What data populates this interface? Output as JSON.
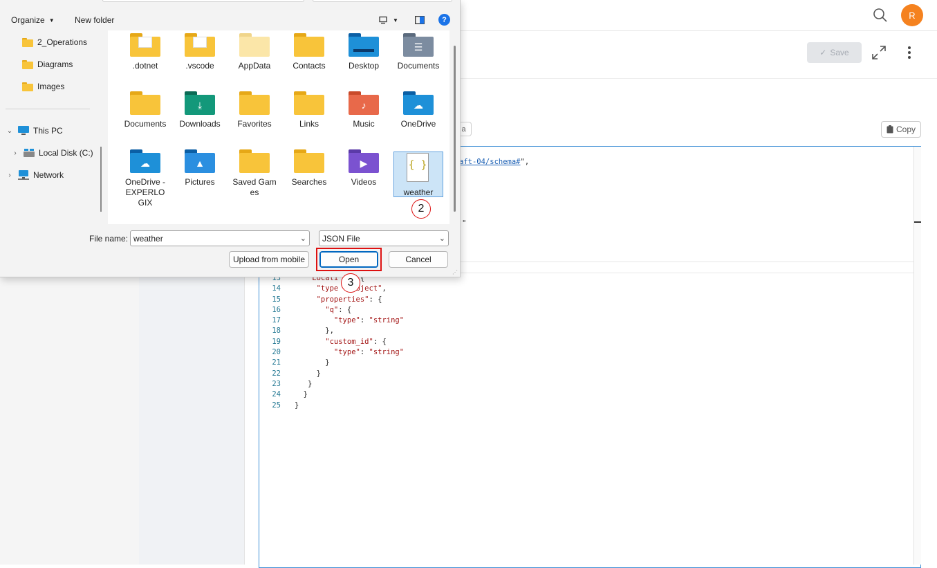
{
  "app": {
    "avatar_initial": "R",
    "save_label": "Save",
    "copy_label": "Copy",
    "tab_fragment": "a",
    "code_fragment_schema_url": "aft-04/schema#",
    "code_fragment_schema_tail": "\",",
    "code_fragment_quote": "\"",
    "code_lines": [
      {
        "n": "13",
        "html": "<span class=\"p\">    </span><span class=\"k\">Locati</span><span class=\"p\">     {</span>"
      },
      {
        "n": "14",
        "html": "<span class=\"p\">     </span><span class=\"k\">\"type</span><span class=\"p\">    </span><span class=\"s\">bject\"</span><span class=\"p\">,</span>"
      },
      {
        "n": "15",
        "html": "<span class=\"p\">     </span><span class=\"k\">\"properties\"</span><span class=\"p\">: {</span>"
      },
      {
        "n": "16",
        "html": "<span class=\"p\">       </span><span class=\"k\">\"q\"</span><span class=\"p\">: {</span>"
      },
      {
        "n": "17",
        "html": "<span class=\"p\">         </span><span class=\"k\">\"type\"</span><span class=\"p\">: </span><span class=\"s\">\"string\"</span>"
      },
      {
        "n": "18",
        "html": "<span class=\"p\">       },</span>"
      },
      {
        "n": "19",
        "html": "<span class=\"p\">       </span><span class=\"k\">\"custom_id\"</span><span class=\"p\">: {</span>"
      },
      {
        "n": "20",
        "html": "<span class=\"p\">         </span><span class=\"k\">\"type\"</span><span class=\"p\">: </span><span class=\"s\">\"string\"</span>"
      },
      {
        "n": "21",
        "html": "<span class=\"p\">       }</span>"
      },
      {
        "n": "22",
        "html": "<span class=\"p\">     }</span>"
      },
      {
        "n": "23",
        "html": "<span class=\"p\">   }</span>"
      },
      {
        "n": "24",
        "html": "<span class=\"p\">  }</span>"
      },
      {
        "n": "25",
        "html": "<span class=\"p\">}</span>"
      }
    ]
  },
  "dialog": {
    "toolbar": {
      "organize": "Organize",
      "new_folder": "New folder",
      "help": "?"
    },
    "nav": [
      {
        "label": "2_Operations",
        "icon": "folder-icon"
      },
      {
        "label": "Diagrams",
        "icon": "folder-icon"
      },
      {
        "label": "Images",
        "icon": "folder-icon"
      },
      {
        "label": "This PC",
        "icon": "monitor-icon"
      },
      {
        "label": "Local Disk (C:)",
        "icon": "drive-icon"
      },
      {
        "label": "Network",
        "icon": "network-icon"
      }
    ],
    "files": [
      {
        "label": ".dotnet",
        "kind": "folder-doc"
      },
      {
        "label": ".vscode",
        "kind": "folder-doc"
      },
      {
        "label": "AppData",
        "kind": "folder-light"
      },
      {
        "label": "Contacts",
        "kind": "folder"
      },
      {
        "label": "Desktop",
        "kind": "desktop"
      },
      {
        "label": "Documents",
        "kind": "documents"
      },
      {
        "label": "Documents",
        "kind": "folder"
      },
      {
        "label": "Downloads",
        "kind": "downloads"
      },
      {
        "label": "Favorites",
        "kind": "folder"
      },
      {
        "label": "Links",
        "kind": "folder"
      },
      {
        "label": "Music",
        "kind": "music"
      },
      {
        "label": "OneDrive",
        "kind": "cloud"
      },
      {
        "label": "OneDrive - EXPERLOGIX",
        "kind": "cloud"
      },
      {
        "label": "Pictures",
        "kind": "pictures"
      },
      {
        "label": "Saved Games",
        "kind": "folder"
      },
      {
        "label": "Searches",
        "kind": "folder"
      },
      {
        "label": "Videos",
        "kind": "videos"
      },
      {
        "label": "weather",
        "kind": "json"
      }
    ],
    "file_name_label": "File name:",
    "file_name_value": "weather",
    "file_type_value": "JSON File",
    "upload_label": "Upload from mobile",
    "open_label": "Open",
    "cancel_label": "Cancel",
    "annotation_2": "2",
    "annotation_3": "3",
    "colors": {
      "folder": "#f8c43a",
      "accent": "#0067c0",
      "highlight": "#dd1111"
    }
  }
}
